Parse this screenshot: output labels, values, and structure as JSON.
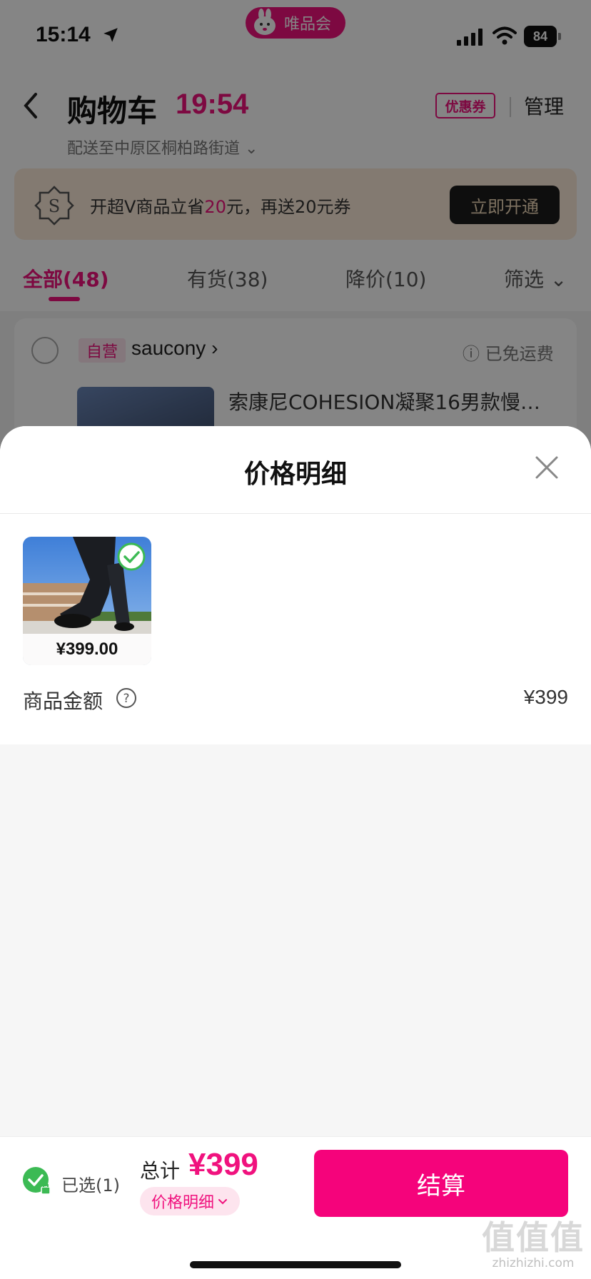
{
  "status_bar": {
    "time": "15:14",
    "app_badge": "唯品会",
    "battery": "84"
  },
  "header": {
    "title": "购物车",
    "countdown": "19:54",
    "address": "配送至中原区桐柏路街道",
    "coupon_label": "优惠券",
    "manage_label": "管理"
  },
  "vip_banner": {
    "text_prefix": "开超V商品立省",
    "highlight": "20",
    "text_suffix": "元，再送20元券",
    "button": "立即开通"
  },
  "tabs": [
    {
      "label": "全部(48)",
      "active": true
    },
    {
      "label": "有货(38)",
      "active": false
    },
    {
      "label": "降价(10)",
      "active": false
    },
    {
      "label": "筛选",
      "active": false
    }
  ],
  "store": {
    "self_operated": "自营",
    "brand": "saucony",
    "shipping": "已免运费",
    "product_title": "索康尼COHESION凝聚16男款慢…"
  },
  "sheet": {
    "title": "价格明细",
    "item_price": "¥399.00",
    "amount_label": "商品金额",
    "amount_value": "¥399"
  },
  "bottom_bar": {
    "selected": "已选(1)",
    "total_label": "总计",
    "total_value": "¥399",
    "detail_label": "价格明细",
    "checkout_label": "结算"
  },
  "watermark": {
    "logo_text": "值值值",
    "site": "zhizhizhi.com"
  },
  "colors": {
    "accent": "#f0127e",
    "checkout": "#f5037b",
    "success": "#3cba54"
  },
  "icons": [
    "back-icon",
    "location-arrow-icon",
    "signal-icon",
    "wifi-icon",
    "battery-icon",
    "vip-s-icon",
    "chevron-down-icon",
    "close-icon",
    "check-circle-icon",
    "help-icon",
    "lock-check-icon"
  ]
}
